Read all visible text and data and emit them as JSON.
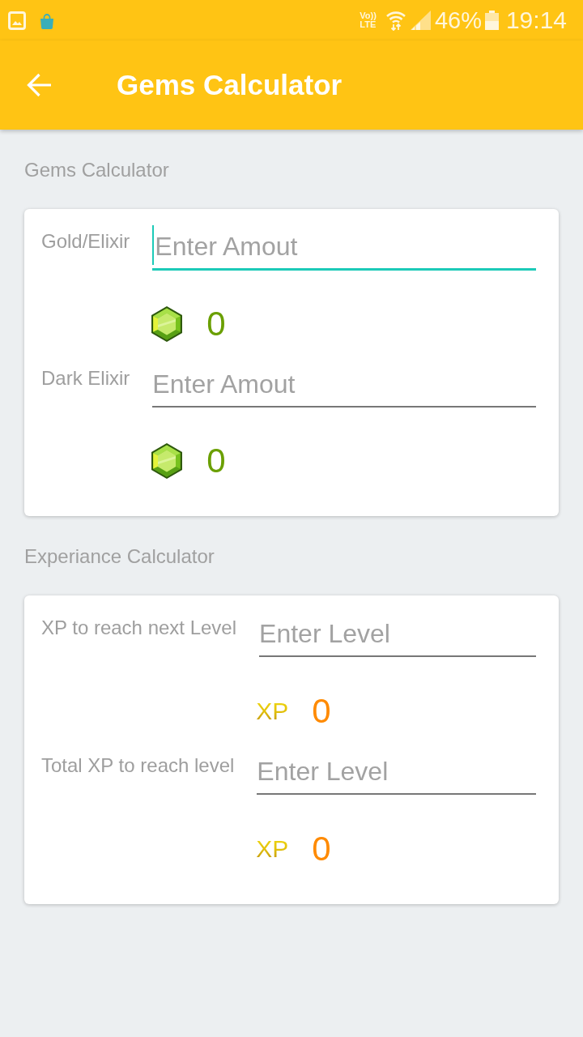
{
  "status_bar": {
    "volte": "Vo))",
    "network": "LTE",
    "battery": "46%",
    "time": "19:14"
  },
  "app_bar": {
    "title": "Gems Calculator"
  },
  "sections": [
    {
      "title": "Gems Calculator",
      "rows": [
        {
          "label": "Gold/Elixir",
          "placeholder": "Enter Amout",
          "focused": true,
          "result": {
            "kind": "gem",
            "value": "0"
          }
        },
        {
          "label": "Dark Elixir",
          "placeholder": "Enter Amout",
          "focused": false,
          "result": {
            "kind": "gem",
            "value": "0"
          }
        }
      ]
    },
    {
      "title": "Experiance Calculator",
      "rows": [
        {
          "label": "XP to reach next Level",
          "placeholder": "Enter Level",
          "focused": false,
          "result": {
            "kind": "xp",
            "unit": "XP",
            "value": "0"
          }
        },
        {
          "label": "Total XP to reach level",
          "placeholder": "Enter Level",
          "focused": false,
          "result": {
            "kind": "xp",
            "unit": "XP",
            "value": "0"
          }
        }
      ]
    }
  ]
}
